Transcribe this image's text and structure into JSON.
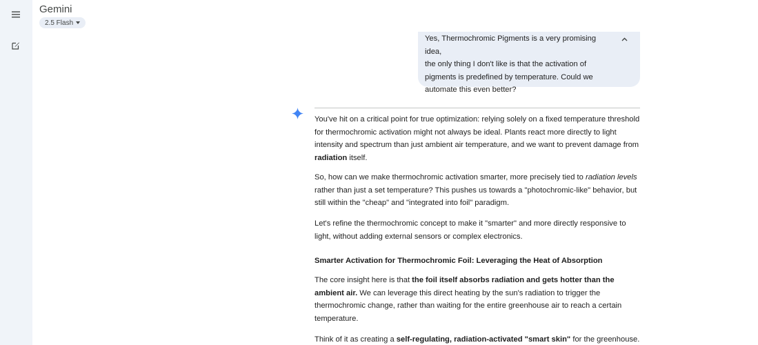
{
  "app": {
    "title": "Gemini",
    "model_selector": "2.5 Flash"
  },
  "rail": {
    "icons": [
      "menu-icon",
      "new-chat-icon"
    ]
  },
  "user_message": {
    "lines": [
      "Yes, Thermochromic Pigments is a very promising idea,",
      "the only thing I don't like is that the activation of",
      "pigments is predefined by temperature. Could we",
      "automate this even better?"
    ]
  },
  "response": {
    "p1": {
      "a": "You've hit on a critical point for true optimization: relying solely on a fixed temperature threshold for thermochromic activation might not always be ideal. Plants react more directly to light intensity and spectrum than just ambient air temperature, and we want to prevent damage from ",
      "b": "radiation",
      "c": " itself."
    },
    "p2": {
      "a": "So, how can we make thermochromic activation smarter, more precisely tied to ",
      "b": "radiation levels",
      "c": " rather than just a set temperature? This pushes us towards a \"photochromic-like\" behavior, but still within the \"cheap\" and \"integrated into foil\" paradigm."
    },
    "p3": "Let's refine the thermochromic concept to make it \"smarter\" and more directly responsive to light, without adding external sensors or complex electronics.",
    "heading": "Smarter Activation for Thermochromic Foil: Leveraging the Heat of Absorption",
    "p4": {
      "a": "The core insight here is that ",
      "b": "the foil itself absorbs radiation and gets hotter than the ambient air.",
      "c": " We can leverage this direct heating by the sun's radiation to trigger the thermochromic change, rather than waiting for the entire greenhouse air to reach a certain temperature."
    },
    "p5": {
      "a": "Think of it as creating a ",
      "b": "self-regulating, radiation-activated \"smart skin\"",
      "c": " for the greenhouse."
    }
  },
  "colors": {
    "rail_bg": "#f0f4f9",
    "bubble_bg": "#e9eef6",
    "spark_blue": "#4285f4"
  }
}
